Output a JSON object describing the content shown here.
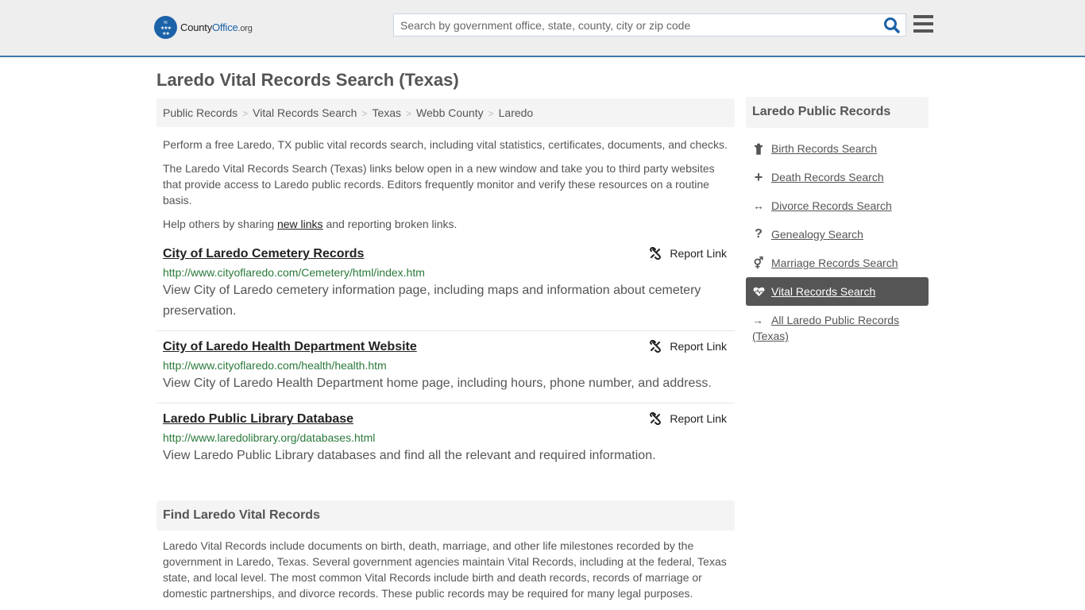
{
  "header": {
    "logo": {
      "name_part1": "County",
      "name_part2": "Office",
      "tld": ".org"
    },
    "search": {
      "placeholder": "Search by government office, state, county, city or zip code",
      "value": ""
    }
  },
  "page": {
    "title": "Laredo Vital Records Search (Texas)"
  },
  "breadcrumb": [
    {
      "label": "Public Records"
    },
    {
      "label": "Vital Records Search"
    },
    {
      "label": "Texas"
    },
    {
      "label": "Webb County"
    },
    {
      "label": "Laredo"
    }
  ],
  "intro": {
    "p1": "Perform a free Laredo, TX public vital records search, including vital statistics, certificates, documents, and checks.",
    "p2": "The Laredo Vital Records Search (Texas) links below open in a new window and take you to third party websites that provide access to Laredo public records. Editors frequently monitor and verify these resources on a routine basis.",
    "p3_before": "Help others by sharing ",
    "p3_link": "new links",
    "p3_after": " and reporting broken links."
  },
  "listings": [
    {
      "title": "City of Laredo Cemetery Records",
      "url": "http://www.cityoflaredo.com/Cemetery/html/index.htm",
      "description": "View City of Laredo cemetery information page, including maps and information about cemetery preservation.",
      "report_label": "Report Link"
    },
    {
      "title": "City of Laredo Health Department Website",
      "url": "http://www.cityoflaredo.com/health/health.htm",
      "description": "View City of Laredo Health Department home page, including hours, phone number, and address.",
      "report_label": "Report Link"
    },
    {
      "title": "Laredo Public Library Database",
      "url": "http://www.laredolibrary.org/databases.html",
      "description": "View Laredo Public Library databases and find all the relevant and required information.",
      "report_label": "Report Link"
    }
  ],
  "find_section": {
    "heading": "Find Laredo Vital Records",
    "body": "Laredo Vital Records include documents on birth, death, marriage, and other life milestones recorded by the government in Laredo, Texas. Several government agencies maintain Vital Records, including at the federal, Texas state, and local level. The most common Vital Records include birth and death records, records of marriage or domestic partnerships, and divorce records. These public records may be required for many legal purposes."
  },
  "sidebar": {
    "heading": "Laredo Public Records",
    "items": [
      {
        "label": "Birth Records Search",
        "icon": "child-icon",
        "active": false
      },
      {
        "label": "Death Records Search",
        "icon": "plus-icon",
        "active": false
      },
      {
        "label": "Divorce Records Search",
        "icon": "arrows-horizontal-icon",
        "active": false
      },
      {
        "label": "Genealogy Search",
        "icon": "question-icon",
        "active": false
      },
      {
        "label": "Marriage Records Search",
        "icon": "venus-mars-icon",
        "active": false
      },
      {
        "label": "Vital Records Search",
        "icon": "heartbeat-icon",
        "active": true
      },
      {
        "label": "All Laredo Public Records (Texas)",
        "icon": "arrow-right-icon",
        "active": false
      }
    ]
  },
  "colors": {
    "brand_blue": "#1b62a8",
    "header_border": "#3e79ab",
    "url_green": "#2a7a3a",
    "active_item_bg": "#555555"
  }
}
